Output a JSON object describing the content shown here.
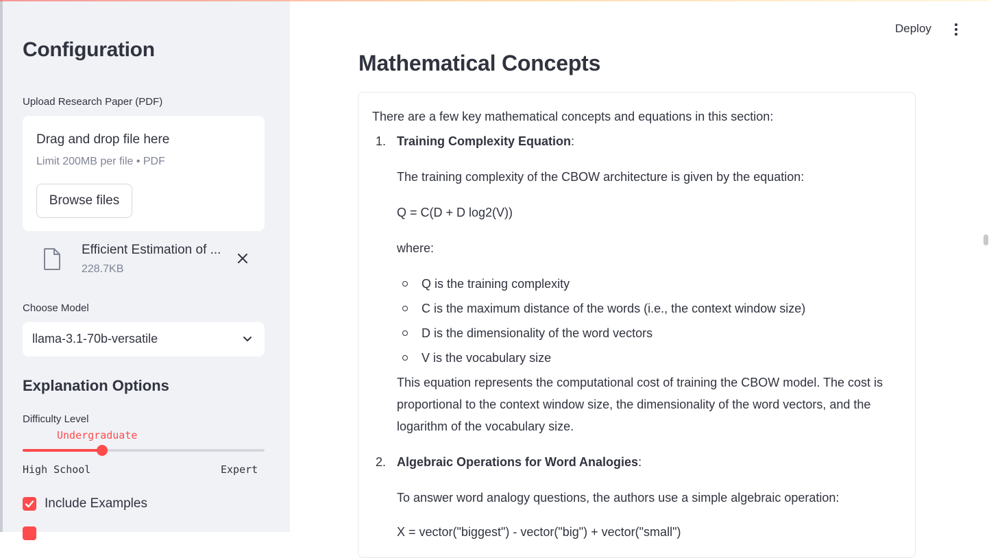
{
  "sidebar": {
    "title": "Configuration",
    "upload": {
      "label": "Upload Research Paper (PDF)",
      "drop_text": "Drag and drop file here",
      "limit_text": "Limit 200MB per file • PDF",
      "browse_label": "Browse files"
    },
    "file": {
      "name": "Efficient Estimation of ...",
      "size": "228.7KB"
    },
    "model": {
      "label": "Choose Model",
      "value": "llama-3.1-70b-versatile"
    },
    "options": {
      "heading": "Explanation Options",
      "difficulty_label": "Difficulty Level",
      "difficulty_value": "Undergraduate",
      "difficulty_min": "High School",
      "difficulty_max": "Expert",
      "difficulty_fraction": 0.33,
      "include_examples_label": "Include Examples",
      "include_examples_checked": true
    }
  },
  "header": {
    "deploy_label": "Deploy",
    "menu_icon": "more-vertical-icon"
  },
  "main": {
    "title": "Mathematical Concepts",
    "intro": "There are a few key mathematical concepts and equations in this section:",
    "items": [
      {
        "number": "1.",
        "heading": "Training Complexity Equation",
        "colon": ":",
        "p1": "The training complexity of the CBOW architecture is given by the equation:",
        "equation": "Q = C(D + D log2(V))",
        "where": "where:",
        "bullets": [
          "Q is the training complexity",
          "C is the maximum distance of the words (i.e., the context window size)",
          "D is the dimensionality of the word vectors",
          "V is the vocabulary size"
        ],
        "p2_lines": [
          "This equation represents the computational cost of training the CBOW model. The cost is",
          "proportional to the context window size, the dimensionality of the word vectors, and the",
          "logarithm of the vocabulary size."
        ]
      },
      {
        "number": "2.",
        "heading": "Algebraic Operations for Word Analogies",
        "colon": ":",
        "p1": "To answer word analogy questions, the authors use a simple algebraic operation:",
        "equation_partial": "X = vector(\"biggest\") - vector(\"big\") + vector(\"small\")"
      }
    ]
  },
  "colors": {
    "accent": "#ff4b4b",
    "sidebar_bg": "#f0f2f6",
    "text": "#31333f",
    "muted": "#808495"
  }
}
